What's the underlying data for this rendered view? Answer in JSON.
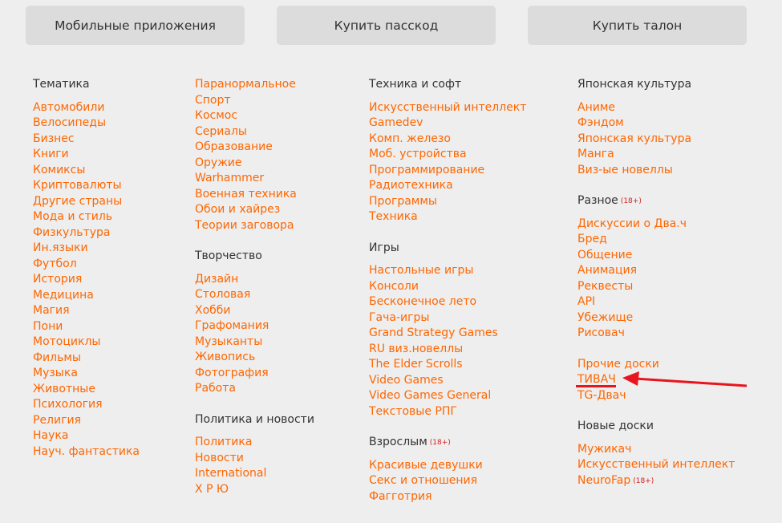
{
  "top_buttons": [
    {
      "label": "Мобильные приложения"
    },
    {
      "label": "Купить пасскод"
    },
    {
      "label": "Купить талон"
    }
  ],
  "columns": [
    {
      "sections": [
        {
          "title": "Тематика",
          "badge": "",
          "links": [
            "Автомобили",
            "Велосипеды",
            "Бизнес",
            "Книги",
            "Комиксы",
            "Криптовалюты",
            "Другие страны",
            "Мода и стиль",
            "Физкультура",
            "Ин.языки",
            "Футбол",
            "История",
            "Медицина",
            "Магия",
            "Пони",
            "Мотоциклы",
            "Фильмы",
            "Музыка",
            "Животные",
            "Психология",
            "Религия",
            "Наука",
            "Науч. фантастика"
          ]
        }
      ]
    },
    {
      "sections": [
        {
          "title": "",
          "badge": "",
          "links": [
            "Паранормальное",
            "Спорт",
            "Космос",
            "Сериалы",
            "Образование",
            "Оружие",
            "Warhammer",
            "Военная техника",
            "Обои и хайрез",
            "Теории заговора"
          ]
        },
        {
          "title": "Творчество",
          "badge": "",
          "links": [
            "Дизайн",
            "Столовая",
            "Хобби",
            "Графомания",
            "Музыканты",
            "Живопись",
            "Фотография",
            "Работа"
          ]
        },
        {
          "title": "Политика и новости",
          "badge": "",
          "links": [
            "Политика",
            "Новости",
            "International",
            "Х Р Ю"
          ]
        }
      ]
    },
    {
      "sections": [
        {
          "title": "Техника и софт",
          "badge": "",
          "links": [
            "Искусственный интеллект",
            "Gamedev",
            "Комп. железо",
            "Моб. устройства",
            "Программирование",
            "Радиотехника",
            "Программы",
            "Техника"
          ]
        },
        {
          "title": "Игры",
          "badge": "",
          "links": [
            "Настольные игры",
            "Консоли",
            "Бесконечное лето",
            "Гача-игры",
            "Grand Strategy Games",
            "RU виз.новеллы",
            "The Elder Scrolls",
            "Video Games",
            "Video Games General",
            "Текстовые РПГ"
          ]
        },
        {
          "title": "Взрослым",
          "badge": "(18+)",
          "links": [
            "Красивые девушки",
            "Секс и отношения",
            "Фагготрия"
          ]
        }
      ]
    },
    {
      "sections": [
        {
          "title": "Японская культура",
          "badge": "",
          "links": [
            "Аниме",
            "Фэндом",
            "Японская культура",
            "Манга",
            "Виз-ые новеллы"
          ]
        },
        {
          "title": "Разное",
          "badge": "(18+)",
          "links": [
            "Дискуссии о Два.ч",
            "Бред",
            "Общение",
            "Анимация",
            "Реквесты",
            "API",
            "Убежище",
            "Рисовач"
          ]
        },
        {
          "title": "",
          "badge": "",
          "links": [
            "Прочие доски",
            "ТИВАЧ",
            "TG-Двач"
          ]
        },
        {
          "title": "Новые доски",
          "badge": "",
          "links": [
            "Мужикач",
            "Искусственный интеллект",
            "NeuroFap"
          ],
          "link_badges": {
            "2": "(18+)"
          }
        }
      ]
    }
  ],
  "annotation": {
    "color": "#e8141e",
    "target": "ТИВАЧ"
  },
  "colors": {
    "link": "#ff6600",
    "badge": "#d32020",
    "button_bg": "#dcdcdc",
    "page_bg": "#eeeeee"
  }
}
